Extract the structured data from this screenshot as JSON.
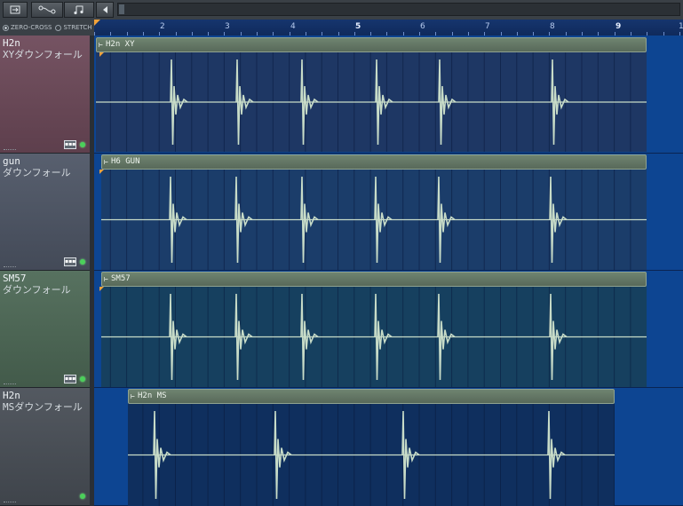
{
  "toolbar": {
    "buttons": [
      {
        "name": "snap-button",
        "icon": "snap-icon"
      },
      {
        "name": "slide-tool-button",
        "icon": "curve-icon"
      },
      {
        "name": "note-tool-button",
        "icon": "music-note-icon"
      },
      {
        "name": "scroll-left-button",
        "icon": "triangle-left-icon"
      }
    ]
  },
  "snap_options": {
    "zero_cross": "ZERO-CROSS",
    "stretch": "STRETCH"
  },
  "ruler": {
    "numbers": [
      "2",
      "3",
      "4",
      "5",
      "6",
      "7",
      "8",
      "9",
      "1"
    ]
  },
  "tracks": [
    {
      "name": "H2n",
      "sub": "XYダウンフォール",
      "clip_label": "H2n XY",
      "color": "#6e4a5a"
    },
    {
      "name": "gun",
      "sub": "ダウンフォール",
      "clip_label": "H6 GUN",
      "color": "#4f5767"
    },
    {
      "name": "SM57",
      "sub": "ダウンフォール",
      "clip_label": "SM57",
      "color": "#4e6a57"
    },
    {
      "name": "H2n",
      "sub": "MSダウンフォール",
      "clip_label": "H2n MS",
      "color": "#4a5058"
    }
  ],
  "colors": {
    "lane_bg": "#1d3766",
    "lane_bg_alt": "#143e63",
    "waveform": "#c8dcc8",
    "accent_orange": "#f2a23a"
  }
}
